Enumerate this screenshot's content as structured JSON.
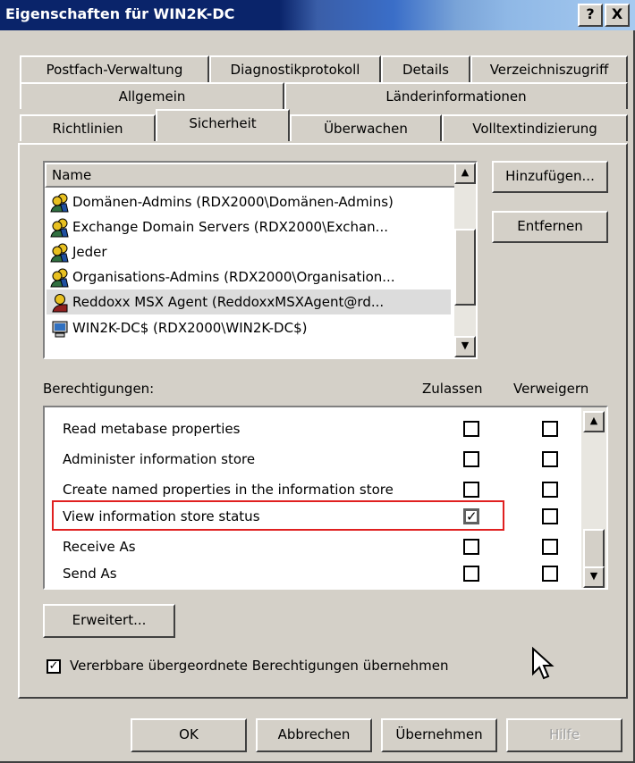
{
  "window": {
    "title": "Eigenschaften für WIN2K-DC",
    "help_btn": "?",
    "close_btn": "X"
  },
  "tabs": {
    "row1": [
      "Postfach-Verwaltung",
      "Diagnostikprotokoll",
      "Details",
      "Verzeichniszugriff"
    ],
    "row2": [
      "Allgemein",
      "Länderinformationen"
    ],
    "row3": [
      "Richtlinien",
      "Sicherheit",
      "Überwachen",
      "Volltextindizierung"
    ],
    "active": "Sicherheit"
  },
  "users": {
    "header": "Name",
    "items": [
      "Domänen-Admins (RDX2000\\Domänen-Admins)",
      "Exchange Domain Servers (RDX2000\\Exchan...",
      "Jeder",
      "Organisations-Admins (RDX2000\\Organisation...",
      "Reddoxx MSX Agent (ReddoxxMSXAgent@rd...",
      "WIN2K-DC$ (RDX2000\\WIN2K-DC$)"
    ],
    "selected": "Reddoxx MSX Agent (ReddoxxMSXAgent@rd..."
  },
  "buttons": {
    "add": "Hinzufügen...",
    "remove": "Entfernen",
    "advanced": "Erweitert...",
    "ok": "OK",
    "cancel": "Abbrechen",
    "apply": "Übernehmen",
    "help": "Hilfe"
  },
  "permissions": {
    "label": "Berechtigungen:",
    "allow_col": "Zulassen",
    "deny_col": "Verweigern",
    "items": [
      {
        "name": "Read metabase properties",
        "allow": false,
        "deny": false
      },
      {
        "name": "Administer information store",
        "allow": false,
        "deny": false
      },
      {
        "name": "Create named properties in the information store",
        "allow": false,
        "deny": false
      },
      {
        "name": "View information store status",
        "allow": true,
        "deny": false
      },
      {
        "name": "Receive As",
        "allow": false,
        "deny": false
      },
      {
        "name": "Send As",
        "allow": false,
        "deny": false
      }
    ],
    "highlighted": "View information store status",
    "highlight_color": "#e02020"
  },
  "inherit": {
    "label": "Vererbbare übergeordnete Berechtigungen übernehmen",
    "checked": true
  },
  "colors": {
    "title_bar": "#0a246a",
    "face": "#d4d0c8"
  }
}
